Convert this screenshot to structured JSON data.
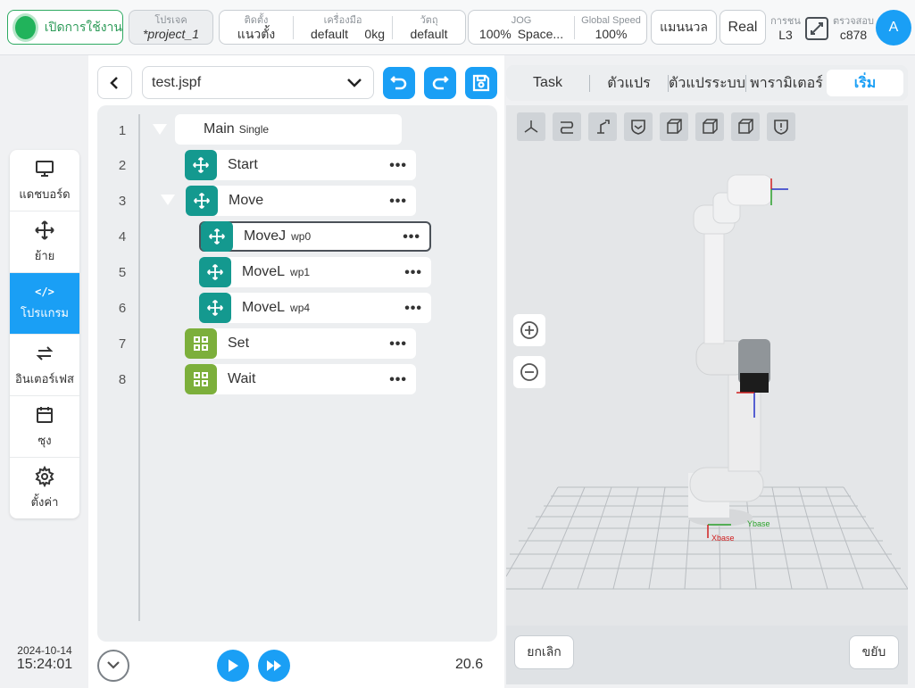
{
  "topbar": {
    "power_label": "เปิดการใช้งาน",
    "project_caption": "โปรเจค",
    "project_value": "*project_1",
    "install_caption": "ติดตั้ง",
    "install_value": "แนวตั้ง",
    "tool_caption": "เครื่องมือ",
    "tool_value": "default",
    "payload_value": "0kg",
    "workpiece_caption": "วัตถุ",
    "workpiece_value": "default",
    "jog_caption": "JOG",
    "jog_percent": "100%",
    "jog_space": "Space...",
    "speed_caption": "Global Speed",
    "speed_value": "100%",
    "mode_label": "แมนนวล",
    "real_label": "Real",
    "perm_caption": "การชน",
    "perm_value": "L3",
    "check_caption": "ตรวจสอบ",
    "check_value": "c878",
    "avatar_letter": "A"
  },
  "nav": {
    "items": [
      {
        "label": "แดชบอร์ด",
        "icon": "monitor-icon"
      },
      {
        "label": "ย้าย",
        "icon": "move-icon"
      },
      {
        "label": "โปรแกรม",
        "icon": "code-icon",
        "glyph": "</>"
      },
      {
        "label": "อินเตอร์เฟส",
        "icon": "interface-icon"
      },
      {
        "label": "ซุง",
        "icon": "calendar-icon"
      },
      {
        "label": "ตั้งค่า",
        "icon": "gear-icon"
      }
    ],
    "active_index": 2
  },
  "datetime": {
    "date": "2024-10-14",
    "time": "15:24:01"
  },
  "program": {
    "file_name": "test.jspf",
    "lines": [
      "1",
      "2",
      "3",
      "4",
      "5",
      "6",
      "7",
      "8"
    ],
    "main": {
      "label": "Main",
      "sub": "Single"
    },
    "nodes": [
      {
        "label": "Start",
        "sub": "",
        "icon": "move-icon",
        "color": "#14998f"
      },
      {
        "label": "Move",
        "sub": "",
        "icon": "move-icon",
        "color": "#14998f"
      },
      {
        "label": "MoveJ",
        "sub": "wp0",
        "icon": "move-icon",
        "color": "#14998f",
        "selected": true
      },
      {
        "label": "MoveL",
        "sub": "wp1",
        "icon": "move-icon",
        "color": "#14998f"
      },
      {
        "label": "MoveL",
        "sub": "wp4",
        "icon": "move-icon",
        "color": "#14998f"
      },
      {
        "label": "Set",
        "sub": "",
        "icon": "grid-icon",
        "color": "#7caf3b"
      },
      {
        "label": "Wait",
        "sub": "",
        "icon": "grid-icon",
        "color": "#7caf3b"
      }
    ],
    "more_glyph": "•••",
    "speed_readout": "20.6"
  },
  "tabs": {
    "items": [
      "Task",
      "ตัวแปร",
      "ตัวแปรระบบ",
      "พารามิเตอร์",
      "เริ่ม"
    ],
    "active_index": 4
  },
  "viewport": {
    "toolbar_icons": [
      "axes-icon",
      "path-icon",
      "robot-icon",
      "shield-icon",
      "cube-front-icon",
      "cube-side-icon",
      "cube-top-icon",
      "warning-shield-icon"
    ],
    "base_x_label": "Xbase",
    "base_y_label": "Ybase"
  },
  "footer": {
    "cancel_label": "ยกเลิก",
    "step_label": "ขยับ"
  },
  "colors": {
    "accent": "#1a9ff5",
    "teal": "#14998f",
    "olive": "#7caf3b",
    "power": "#21b35b"
  }
}
